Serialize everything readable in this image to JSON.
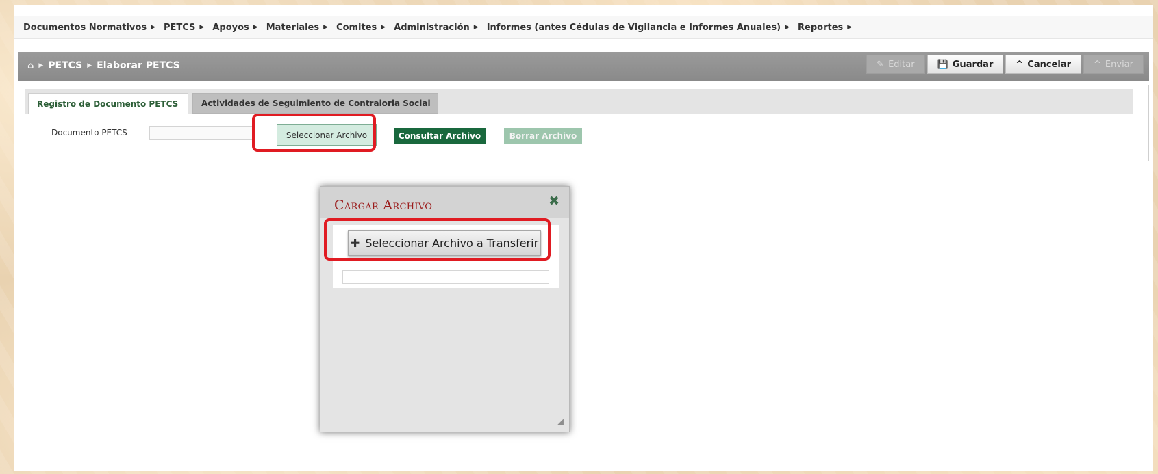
{
  "menu": {
    "items": [
      {
        "label": "Documentos Normativos"
      },
      {
        "label": "PETCS"
      },
      {
        "label": "Apoyos"
      },
      {
        "label": "Materiales"
      },
      {
        "label": "Comites"
      },
      {
        "label": "Administración"
      },
      {
        "label": "Informes (antes Cédulas de Vigilancia e Informes Anuales)"
      },
      {
        "label": "Reportes"
      }
    ],
    "caret_icon": "caret-right-icon"
  },
  "breadcrumb": {
    "home_icon": "home-icon",
    "items": [
      "PETCS",
      "Elaborar PETCS"
    ]
  },
  "actions": {
    "edit": {
      "label": "Editar",
      "icon": "pencil-icon",
      "state": "disabled"
    },
    "save": {
      "label": "Guardar",
      "icon": "floppy-icon"
    },
    "cancel": {
      "label": "Cancelar",
      "icon": "chevron-up-icon"
    },
    "send": {
      "label": "Enviar",
      "icon": "chevron-up-icon",
      "state": "disabled"
    }
  },
  "tabs": [
    {
      "label": "Registro de Documento PETCS",
      "active": true
    },
    {
      "label": "Actividades de Seguimiento de Contraloria Social",
      "active": false
    }
  ],
  "form": {
    "field_label": "Documento PETCS",
    "field_value": "",
    "select_button": "Seleccionar Archivo",
    "consult_button": "Consultar Archivo",
    "delete_button": "Borrar Archivo"
  },
  "dialog": {
    "title": "Cargar Archivo",
    "close_icon": "close-icon",
    "upload_button": "Seleccionar Archivo a Transferir",
    "upload_icon": "plus-icon",
    "upload_field_value": ""
  },
  "colors": {
    "highlight": "#e01b22",
    "primary_green": "#19683d",
    "dialog_title": "#9b1c1c"
  }
}
